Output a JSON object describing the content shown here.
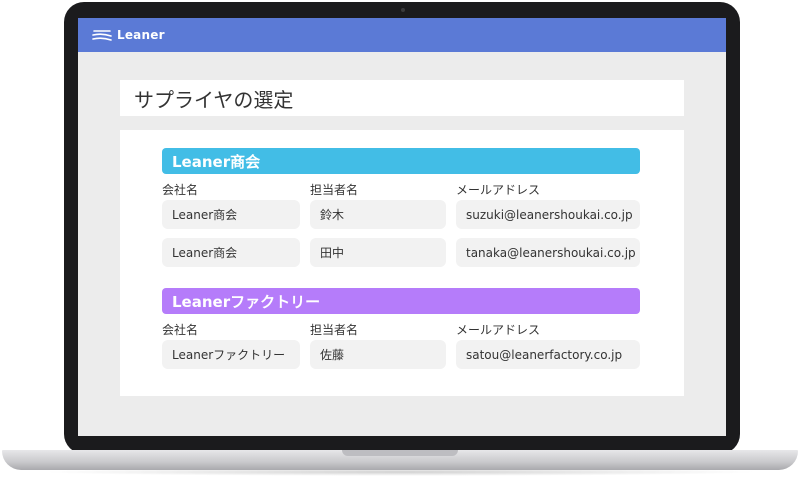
{
  "app": {
    "logo_text": "Leaner",
    "brand_color": "#5b7ad6"
  },
  "page": {
    "title": "サプライヤの選定"
  },
  "columns": {
    "company": "会社名",
    "contact": "担当者名",
    "email": "メールアドレス"
  },
  "suppliers": [
    {
      "name": "Leaner商会",
      "color": "#42bde6",
      "rows": [
        {
          "company": "Leaner商会",
          "contact": "鈴木",
          "email": "suzuki@leanershoukai.co.jp"
        },
        {
          "company": "Leaner商会",
          "contact": "田中",
          "email": "tanaka@leanershoukai.co.jp"
        }
      ]
    },
    {
      "name": "Leanerファクトリー",
      "color": "#b57cfa",
      "rows": [
        {
          "company": "Leanerファクトリー",
          "contact": "佐藤",
          "email": "satou@leanerfactory.co.jp"
        }
      ]
    }
  ]
}
